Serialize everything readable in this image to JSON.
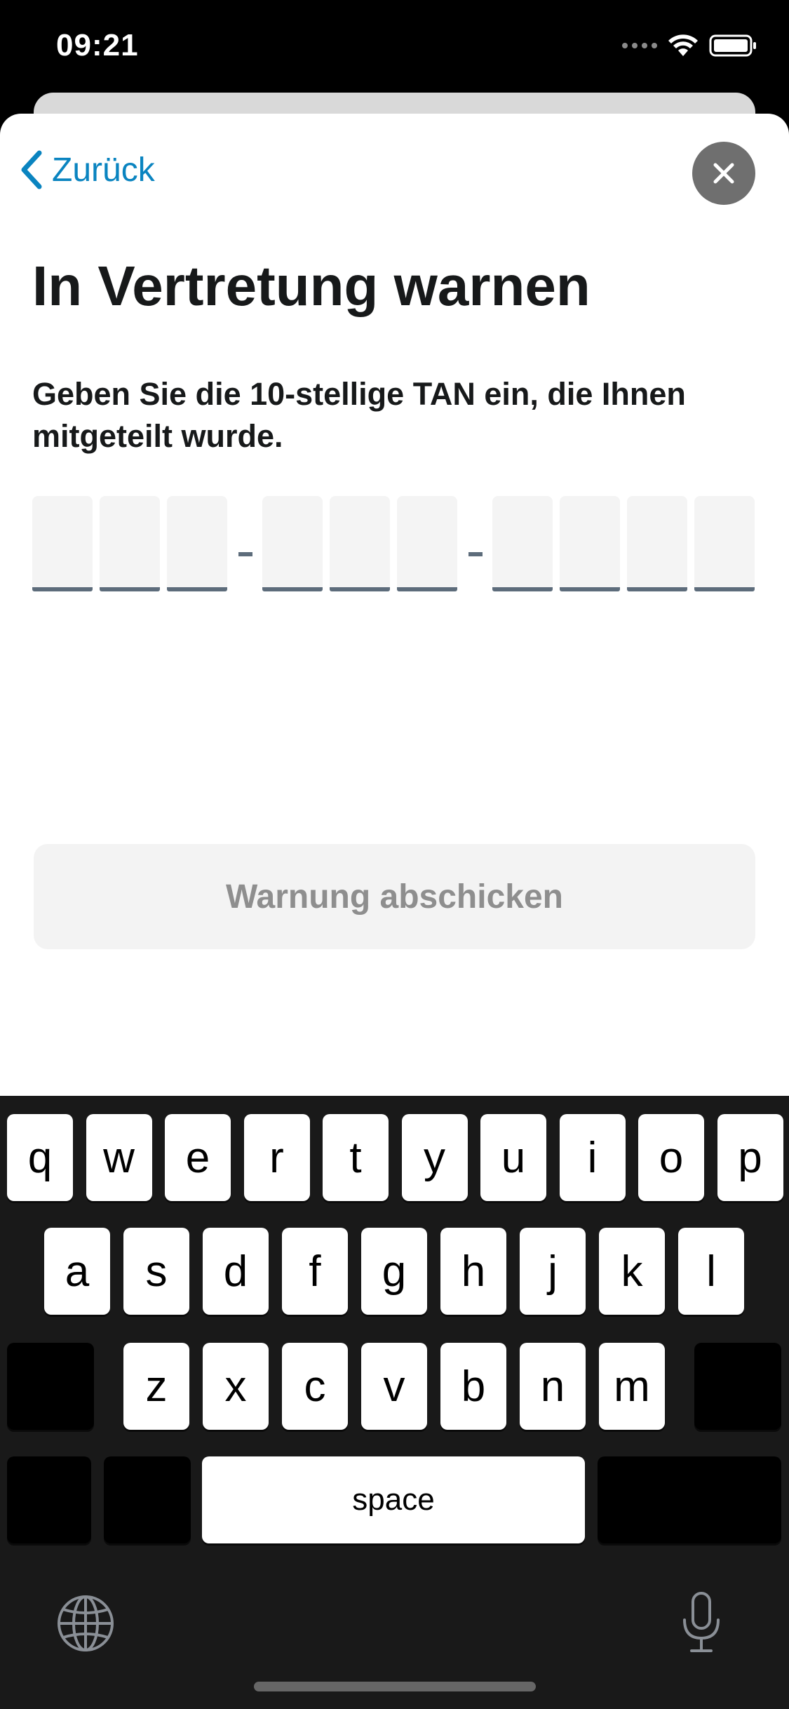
{
  "status_bar": {
    "time": "09:21",
    "wifi_icon": "wifi-icon",
    "battery_icon": "battery-icon",
    "signal_icon": "signal-dots-icon"
  },
  "nav": {
    "back_label": "Zurück",
    "back_icon": "chevron-left-icon",
    "close_icon": "close-icon"
  },
  "title": "In Vertretung warnen",
  "subtitle": "Geben Sie die 10-stellige TAN ein, die Ihnen mitgeteilt wurde.",
  "tan": {
    "digits": [
      "",
      "",
      "",
      "",
      "",
      "",
      "",
      "",
      "",
      ""
    ],
    "groups": [
      3,
      3,
      4
    ],
    "separator": "-"
  },
  "submit_label": "Warnung abschicken",
  "keyboard": {
    "row1": [
      "q",
      "w",
      "e",
      "r",
      "t",
      "y",
      "u",
      "i",
      "o",
      "p"
    ],
    "row2": [
      "a",
      "s",
      "d",
      "f",
      "g",
      "h",
      "j",
      "k",
      "l"
    ],
    "row3": [
      "z",
      "x",
      "c",
      "v",
      "b",
      "n",
      "m"
    ],
    "space_label": "space",
    "globe_icon": "globe-icon",
    "mic_icon": "microphone-icon"
  },
  "colors": {
    "accent": "#0a84c0",
    "tan_underline": "#5d6c7b",
    "disabled_text": "#8e8e8e"
  }
}
